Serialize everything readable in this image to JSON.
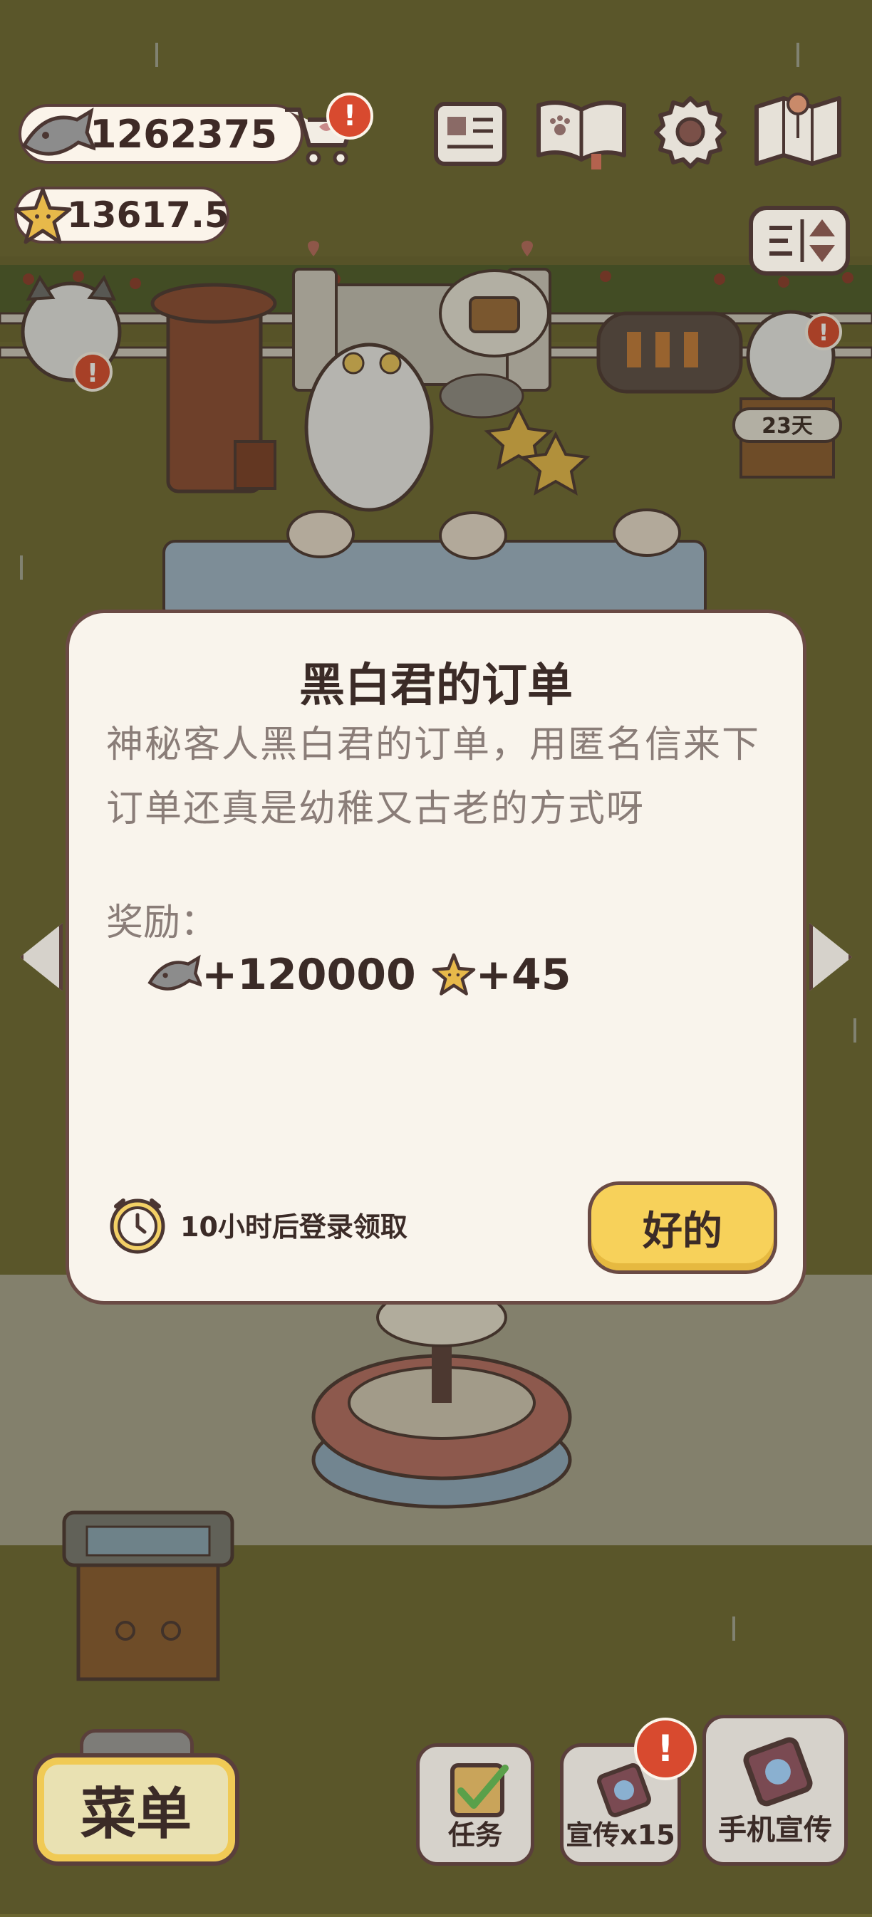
{
  "hud": {
    "fish_amount": "1262375",
    "star_amount": "13617.5",
    "shop_badge": "!"
  },
  "scene": {
    "days_label": "23天"
  },
  "dialog": {
    "title": "黑白君的订单",
    "description": "神秘客人黑白君的订单，用匿名信来下订单还真是幼稚又古老的方式呀",
    "reward_label": "奖励：",
    "fish_reward": "+120000",
    "star_reward": "+45",
    "timer_text": "10小时后登录领取",
    "ok_button": "好的"
  },
  "bottom_bar": {
    "menu_label": "菜单",
    "tasks_label": "任务",
    "promo_label": "宣传x15",
    "phone_promo_label": "手机宣传",
    "promo_badge": "!"
  },
  "colors": {
    "grass": "#6b6630",
    "card_bg": "#f9f4ec",
    "button_yellow": "#f7d15a",
    "alert_red": "#d84a2f",
    "outline": "#5a3f3b"
  }
}
